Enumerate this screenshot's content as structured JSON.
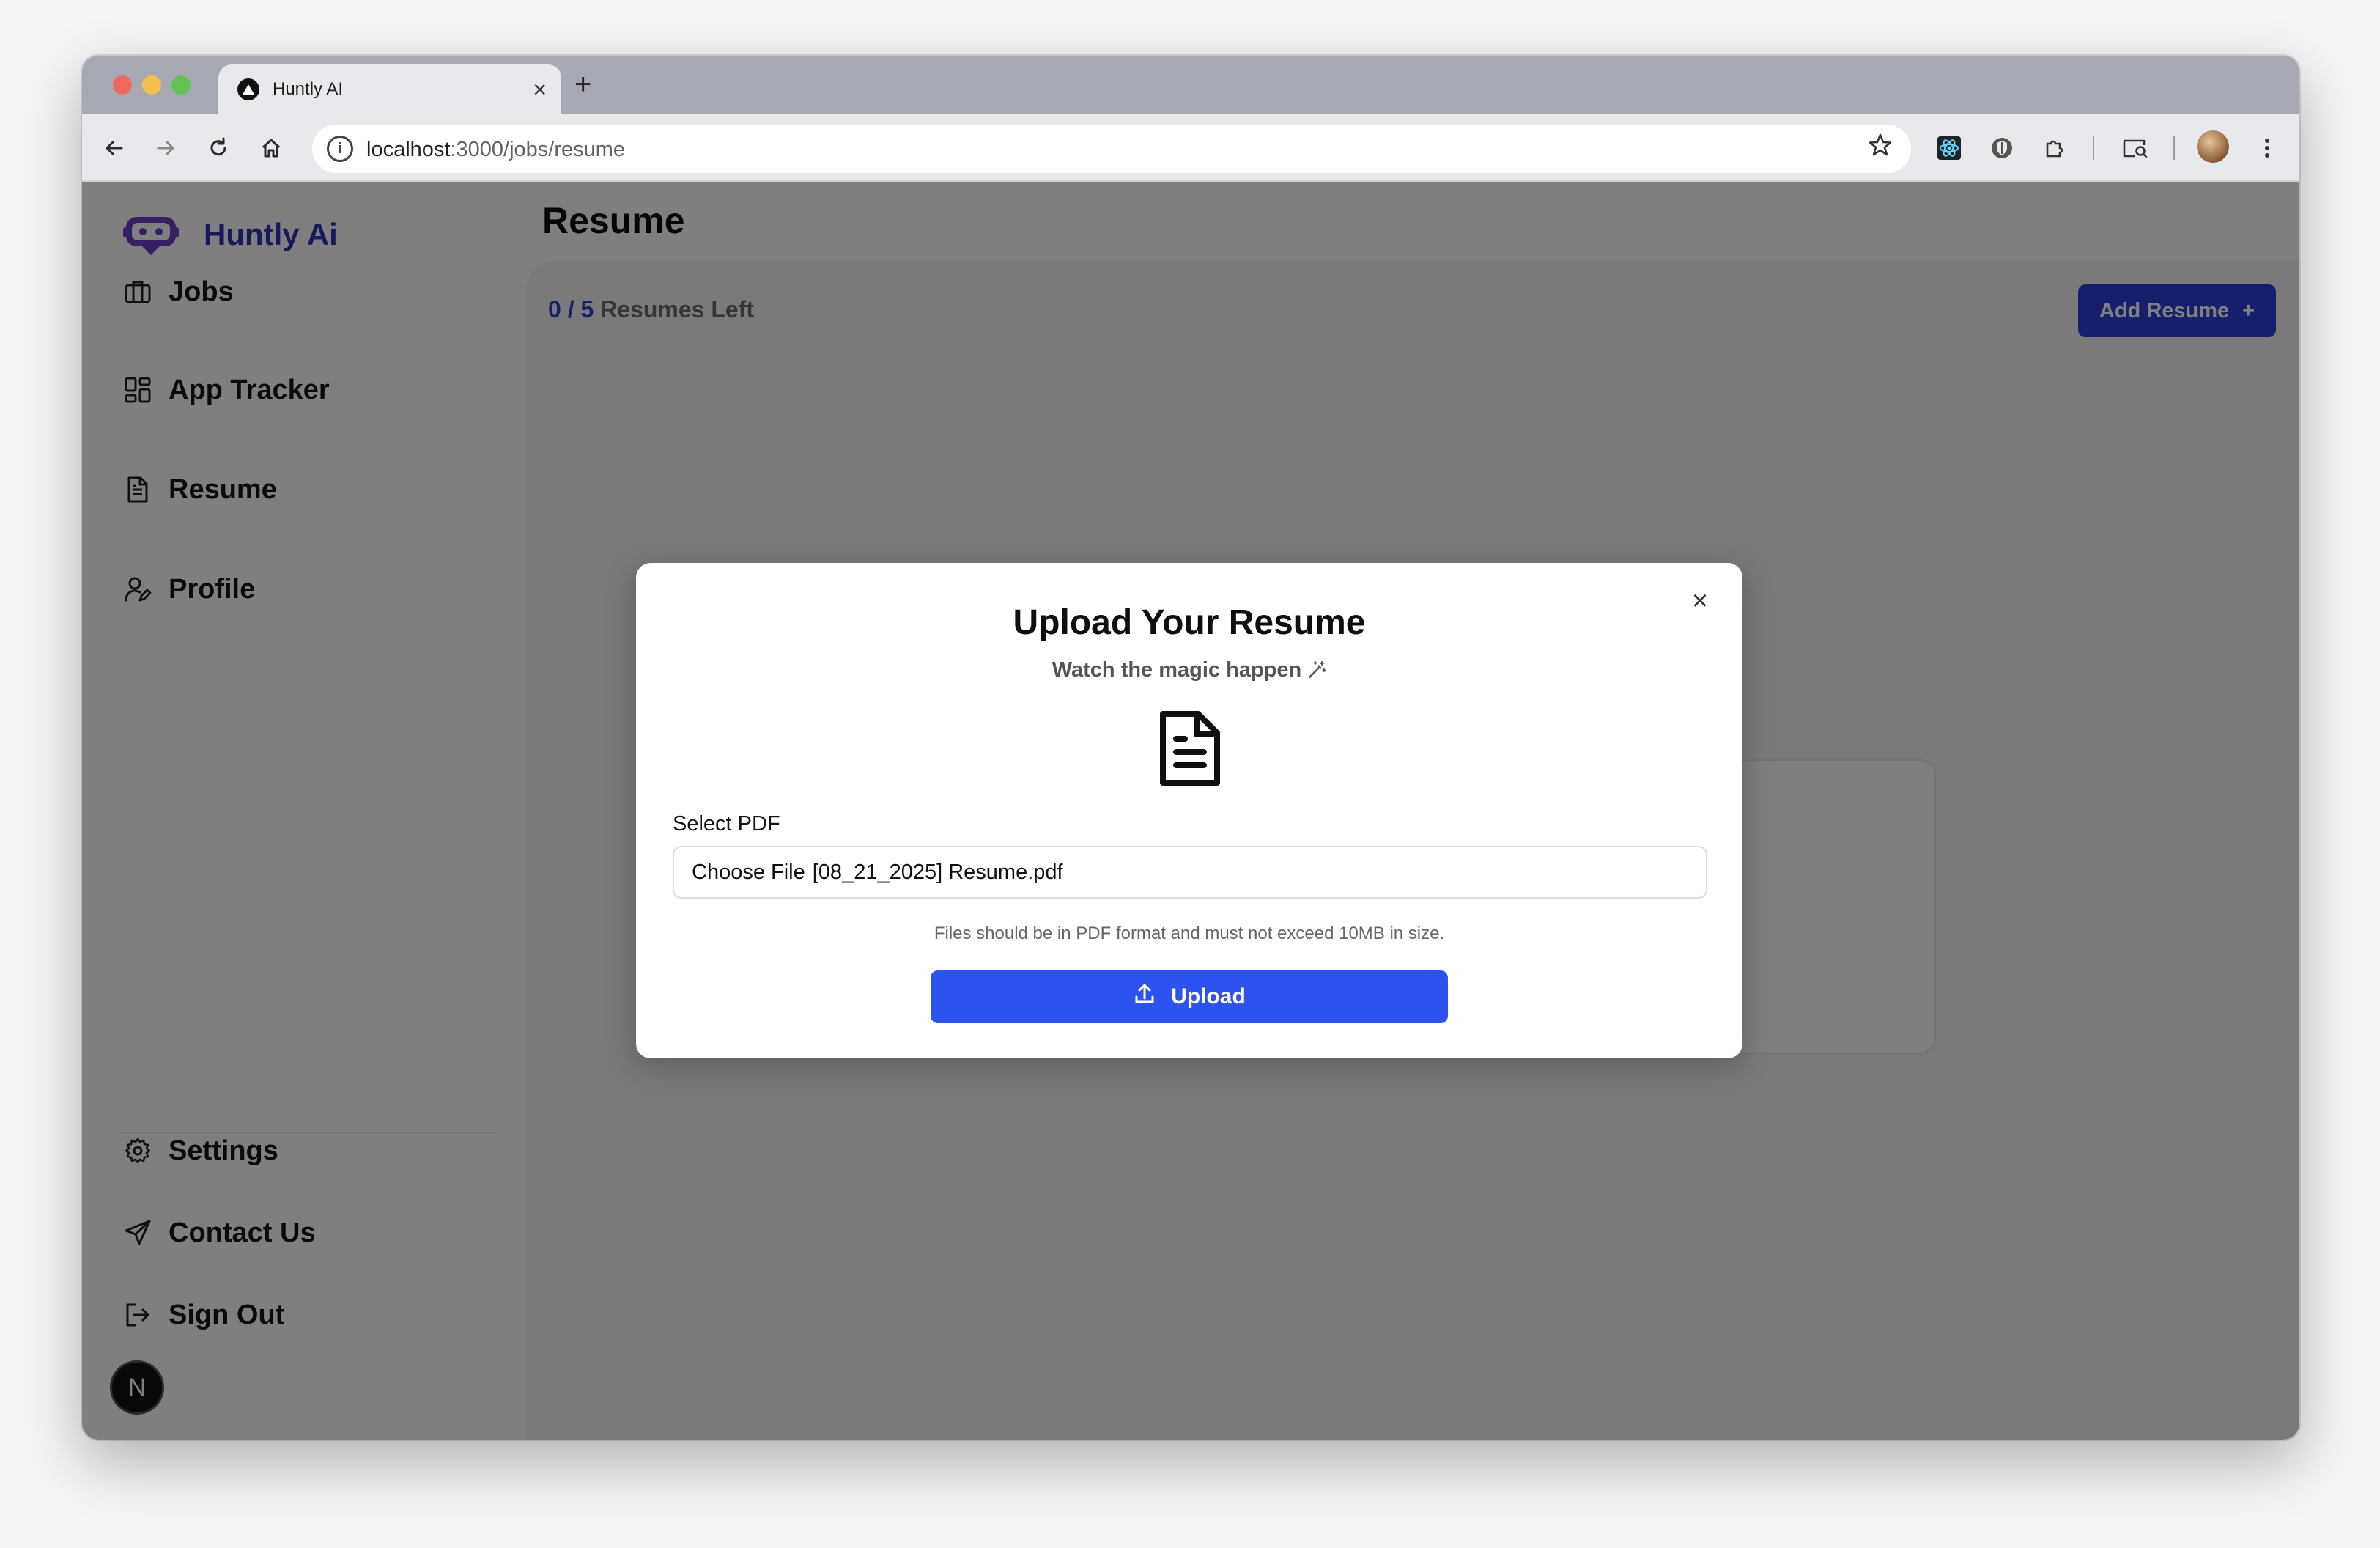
{
  "browser": {
    "tab_title": "Huntly AI",
    "new_tab_glyph": "+",
    "tab_close_glyph": "×",
    "url_host": "localhost",
    "url_path": ":3000/jobs/resume",
    "icons": [
      "back-arrow-icon",
      "forward-arrow-icon",
      "reload-icon",
      "home-icon",
      "info-icon",
      "star-icon",
      "react-devtools-icon",
      "shield-extension-icon",
      "puzzle-extensions-icon",
      "tab-search-icon",
      "profile-avatar",
      "kebab-menu-icon"
    ]
  },
  "sidebar": {
    "brand": "Huntly Ai",
    "nav": [
      {
        "label": "Jobs",
        "icon": "briefcase-icon"
      },
      {
        "label": "App Tracker",
        "icon": "grid-icon"
      },
      {
        "label": "Resume",
        "icon": "document-icon"
      },
      {
        "label": "Profile",
        "icon": "user-edit-icon"
      }
    ],
    "bottom_nav": [
      {
        "label": "Settings",
        "icon": "gear-icon"
      },
      {
        "label": "Contact Us",
        "icon": "send-icon"
      },
      {
        "label": "Sign Out",
        "icon": "sign-out-icon"
      }
    ],
    "dev_badge": "N"
  },
  "main": {
    "page_title": "Resume",
    "quota_used": "0",
    "quota_sep": "/",
    "quota_total": "5",
    "quota_suffix": "Resumes Left",
    "add_resume_label": "Add Resume",
    "add_resume_glyph": "+"
  },
  "modal": {
    "title": "Upload Your Resume",
    "subtitle": "Watch the magic happen",
    "subtitle_icon": "magic-wand-icon",
    "select_label": "Select PDF",
    "choose_file_label": "Choose File",
    "file_name": "[08_21_2025] Resume.pdf",
    "hint": "Files should be in PDF format and must not exceed 10MB in size.",
    "upload_label": "Upload",
    "close_glyph": "×"
  },
  "colors": {
    "brand": "#2b34b8",
    "primary_button": "#2c52f0",
    "add_button": "#2c3fd6",
    "overlay": "rgba(0,0,0,0.5)"
  }
}
